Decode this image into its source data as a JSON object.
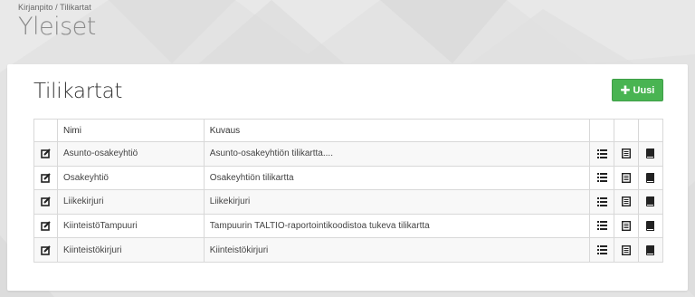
{
  "header": {
    "breadcrumb": "Kirjanpito / Tilikartat",
    "title": "Yleiset"
  },
  "card": {
    "title": "Tilikartat",
    "new_button_label": "Uusi"
  },
  "table": {
    "columns": [
      "Nimi",
      "Kuvaus"
    ],
    "rows": [
      {
        "name": "Asunto-osakeyhtiö",
        "description": "Asunto-osakeyhtiön tilikartta...."
      },
      {
        "name": "Osakeyhtiö",
        "description": "Osakeyhtiön tilikartta"
      },
      {
        "name": "Liikekirjuri",
        "description": "Liikekirjuri"
      },
      {
        "name": "KiinteistöTampuuri",
        "description": "Tampuurin TALTIO-raportointikoodistoa tukeva tilikartta"
      },
      {
        "name": "Kiinteistökirjuri",
        "description": "Kiinteistökirjuri"
      }
    ]
  },
  "icons": {
    "edit": "edit-icon",
    "list": "list-icon",
    "document": "document-icon",
    "book": "book-icon",
    "plus": "plus-icon"
  },
  "colors": {
    "primary_button": "#49b452",
    "page_background": "#e4e4e4"
  }
}
